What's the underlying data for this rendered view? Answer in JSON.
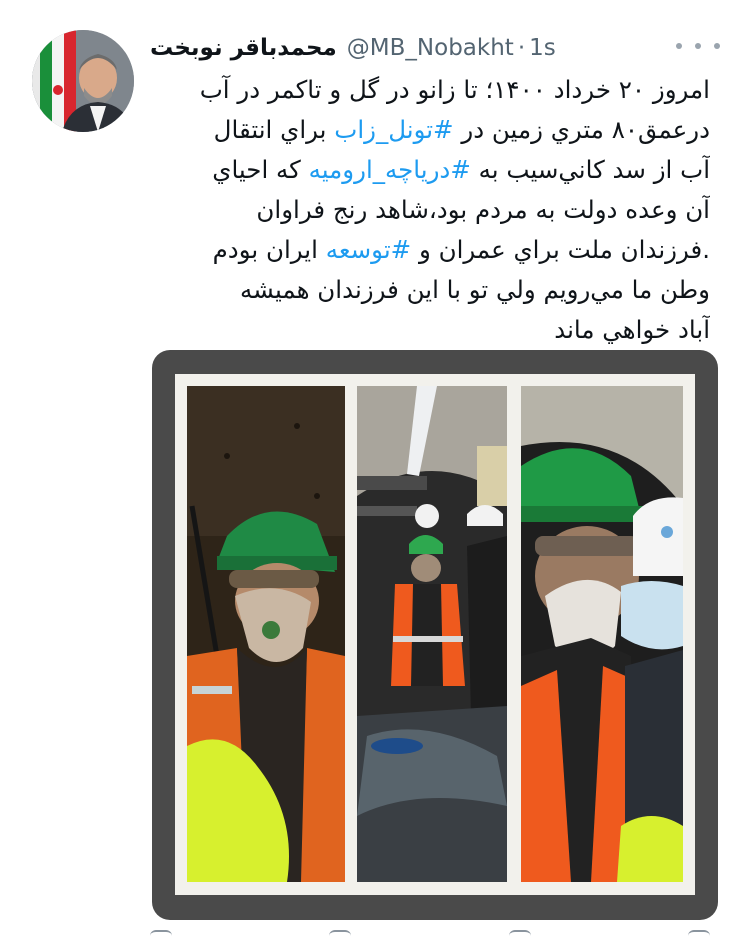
{
  "tweet": {
    "author_name": "محمدباقر نوبخت",
    "handle": "@MB_Nobakht",
    "separator": "·",
    "time": "1s",
    "lines": [
      [
        {
          "t": "امروز ۲۰ خرداد ۱۴۰۰؛ تا زانو در گل و تاكمر در آب"
        }
      ],
      [
        {
          "t": "درعمق۸۰ متري زمين در "
        },
        {
          "t": "#تونل_زاب",
          "tag": true
        },
        {
          "t": " براي انتقال"
        }
      ],
      [
        {
          "t": "آب از سد كاني‌سيب به "
        },
        {
          "t": "#درياچه_اروميه",
          "tag": true
        },
        {
          "t": " كه احياي"
        }
      ],
      [
        {
          "t": "آن وعده دولت به مردم بود،شاهد رنج فراوان"
        }
      ],
      [
        {
          "t": ".فرزندان ملت براي عمران و "
        },
        {
          "t": "#توسعه",
          "tag": true
        },
        {
          "t": " ايران بودم"
        }
      ],
      [
        {
          "t": "وطن ما مي‌رويم ولي تو با اين فرزندان هميشه"
        }
      ],
      [
        {
          "t": "آباد خواهي ماند"
        }
      ]
    ]
  },
  "colors": {
    "hashtag": "#1d9bf0",
    "secondary_text": "#536471",
    "media_frame": "#4a4a4a"
  },
  "icons": {
    "more": "more-horizontal-icon",
    "actions": [
      "reply-icon",
      "retweet-icon",
      "like-icon",
      "share-icon"
    ]
  }
}
